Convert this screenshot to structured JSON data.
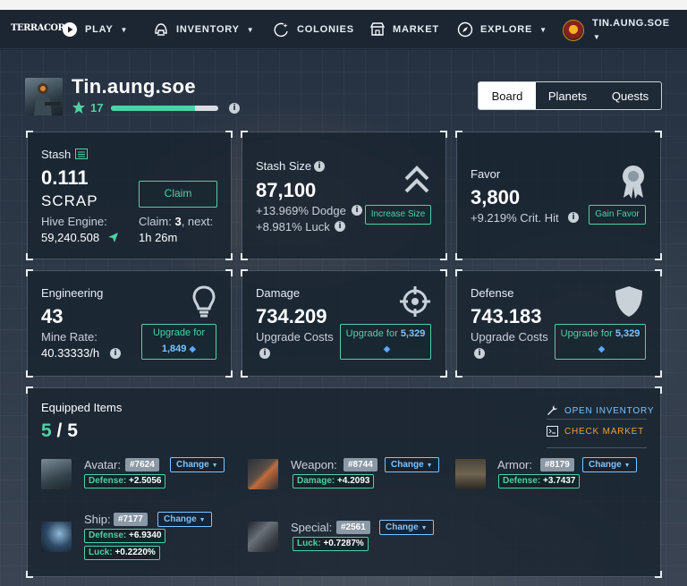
{
  "app": {
    "logo_text": "TERRACORE"
  },
  "nav": {
    "play": "PLAY",
    "inventory": "INVENTORY",
    "colonies": "COLONIES",
    "market": "MARKET",
    "explore": "EXPLORE",
    "profile_name": "TIN.AUNG.SOE"
  },
  "user": {
    "name": "Tin.aung.soe",
    "level": "17",
    "xp_fraction": 0.78
  },
  "tabs": [
    "Board",
    "Planets",
    "Quests"
  ],
  "stash": {
    "label": "Stash",
    "value": "0.111",
    "unit": "SCRAP",
    "hive_label": "Hive Engine:",
    "hive_value": "59,240.508",
    "claim_button": "Claim",
    "claim_prefix": "Claim: ",
    "claim_count": "3",
    "claim_suffix": ", next:",
    "next_time": "1h 26m"
  },
  "stash_size": {
    "label": "Stash Size",
    "value": "87,100",
    "dodge": "+13.969% Dodge",
    "luck": "+8.981% Luck",
    "button": "Increase Size"
  },
  "favor": {
    "label": "Favor",
    "value": "3,800",
    "crit": "+9.219% Crit. Hit",
    "button": "Gain Favor"
  },
  "engineering": {
    "label": "Engineering",
    "value": "43",
    "rate_label": "Mine Rate:",
    "rate_value": "40.33333/h",
    "button_text": "Upgrade for",
    "button_cost": "1,849"
  },
  "damage": {
    "label": "Damage",
    "value": "734.209",
    "costs_label": "Upgrade Costs",
    "button_text": "Upgrade for",
    "button_cost": "5,329"
  },
  "defense": {
    "label": "Defense",
    "value": "743.183",
    "costs_label": "Upgrade Costs",
    "button_text": "Upgrade for",
    "button_cost": "5,329"
  },
  "equipped": {
    "title": "Equipped Items",
    "current": "5",
    "separator": "/",
    "total": "5",
    "open_inventory": "OPEN INVENTORY",
    "check_market": "CHECK MARKET",
    "change_label": "Change",
    "items": {
      "avatar": {
        "slot": "Avatar:",
        "id": "#7624",
        "stat1_k": "Defense:",
        "stat1_v": "+2.5056"
      },
      "weapon": {
        "slot": "Weapon:",
        "id": "#8744",
        "stat1_k": "Damage:",
        "stat1_v": "+4.2093"
      },
      "armor": {
        "slot": "Armor:",
        "id": "#8179",
        "stat1_k": "Defense:",
        "stat1_v": "+3.7437"
      },
      "ship": {
        "slot": "Ship:",
        "id": "#7177",
        "stat1_k": "Defense:",
        "stat1_v": "+6.9340",
        "stat2_k": "Luck:",
        "stat2_v": "+0.2220%"
      },
      "special": {
        "slot": "Special:",
        "id": "#2561",
        "stat1_k": "Luck:",
        "stat1_v": "+0.7287%"
      }
    }
  },
  "colors": {
    "accent": "#4fd1a5",
    "link_blue": "#7cc4ff",
    "market_gold": "#e8a23a"
  }
}
